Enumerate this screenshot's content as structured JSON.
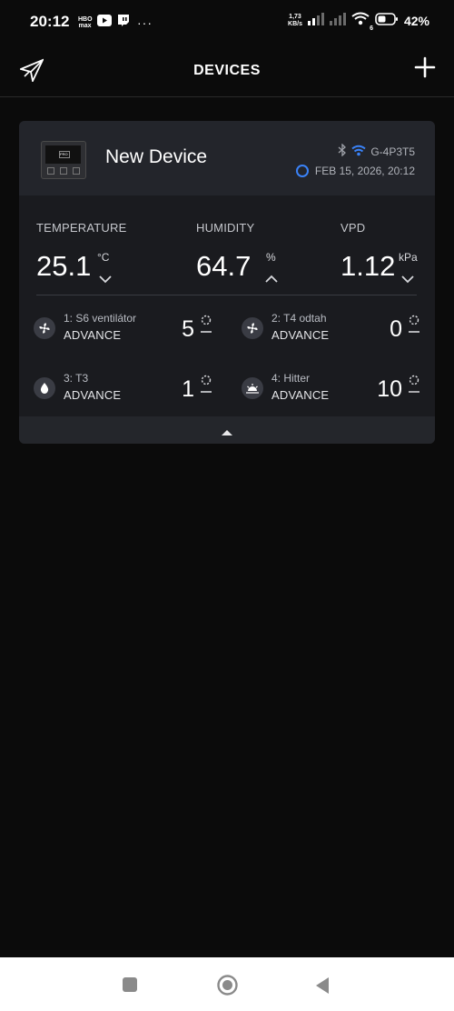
{
  "status_bar": {
    "time": "20:12",
    "hbo_label": "HBO max",
    "speed_value": "1,73",
    "speed_unit": "KB/s",
    "wifi_badge": "6",
    "battery": "42%"
  },
  "app_bar": {
    "title": "DEVICES",
    "logo_icon": "paper-plane-logo-icon",
    "add_icon": "plus-icon"
  },
  "device": {
    "name": "New Device",
    "thumb_text": "PRO",
    "id": "G-4P3T5",
    "updated": "FEB 15, 2026, 20:12",
    "colors": {
      "sync_ring": "#3a82f7",
      "wifi": "#3a82f7"
    }
  },
  "metrics": {
    "temperature": {
      "label": "TEMPERATURE",
      "value": "25.1",
      "unit": "°C",
      "trend": "down"
    },
    "humidity": {
      "label": "HUMIDITY",
      "value": "64.7",
      "unit": "%",
      "trend": "up"
    },
    "vpd": {
      "label": "VPD",
      "value": "1.12",
      "unit": "kPa",
      "trend": "down"
    }
  },
  "channels": [
    {
      "name": "1: S6 ventilátor",
      "mode": "ADVANCE",
      "level": "5",
      "icon": "fan-icon"
    },
    {
      "name": "2: T4 odtah",
      "mode": "ADVANCE",
      "level": "0",
      "icon": "fan-icon"
    },
    {
      "name": "3: T3",
      "mode": "ADVANCE",
      "level": "1",
      "icon": "water-drop-icon"
    },
    {
      "name": "4: Hitter",
      "mode": "ADVANCE",
      "level": "10",
      "icon": "heater-icon"
    }
  ]
}
